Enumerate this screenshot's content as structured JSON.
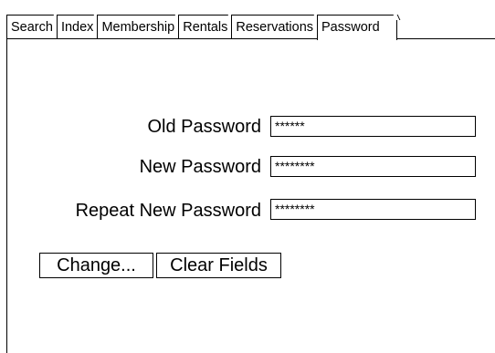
{
  "tabs": [
    {
      "label": "Search",
      "active": false
    },
    {
      "label": "Index",
      "active": false
    },
    {
      "label": "Membership",
      "active": false
    },
    {
      "label": "Rentals",
      "active": false
    },
    {
      "label": "Reservations",
      "active": false
    },
    {
      "label": "Password",
      "active": true
    }
  ],
  "form": {
    "old_password": {
      "label": "Old Password",
      "value": "******"
    },
    "new_password": {
      "label": "New Password",
      "value": "********"
    },
    "repeat_password": {
      "label": "Repeat New Password",
      "value": "********"
    }
  },
  "buttons": {
    "change_label": "Change...",
    "clear_label": "Clear Fields"
  }
}
